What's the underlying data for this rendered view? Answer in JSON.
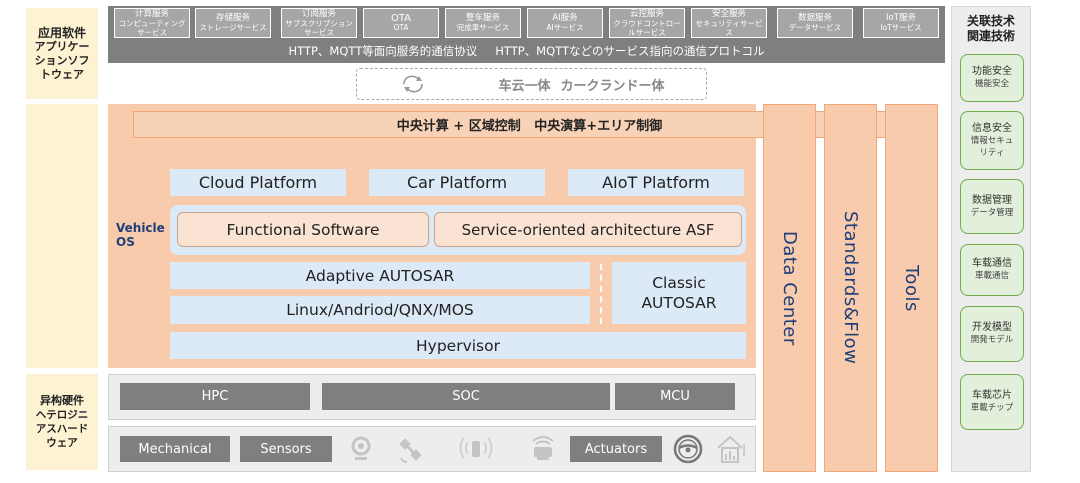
{
  "left_labels": {
    "app_software": {
      "zh": "应用软件",
      "jp": "アプリケーションソフトウェア"
    },
    "hetero_hardware": {
      "zh": "异构硬件",
      "jp": "ヘテロジニアスハードウェア"
    }
  },
  "services": [
    {
      "zh": "计算服务",
      "jp": "コンピューティングサービス"
    },
    {
      "zh": "存储服务",
      "jp": "ストレージサービス"
    },
    {
      "zh": "订阅服务",
      "jp": "サブスクリプションサービス"
    },
    {
      "zh": "OTA",
      "jp": "OTA"
    },
    {
      "zh": "整车服务",
      "jp": "完成車サービス"
    },
    {
      "zh": "AI服务",
      "jp": "AIサービス"
    },
    {
      "zh": "云控服务",
      "jp": "クラウドコントロールサービス"
    },
    {
      "zh": "安全服务",
      "jp": "セキュリティサービス"
    },
    {
      "zh": "数据服务",
      "jp": "データサービス"
    },
    {
      "zh": "IoT服务",
      "jp": "IoTサービス"
    }
  ],
  "protocol": {
    "zh": "HTTP、MQTT等面向服务的通信协议",
    "jp": "HTTP、MQTTなどのサービス指向の通信プロトコル"
  },
  "car_cloud": {
    "zh": "车云一体",
    "jp": "カークランドー体"
  },
  "vehicle_os": {
    "label_line1": "Vehicle",
    "label_line2": "OS",
    "compute_bar": "中央计算 + 区域控制   中央演算+エリア制御",
    "platforms": [
      "Cloud Platform",
      "Car Platform",
      "AIoT Platform"
    ],
    "functional_software": "Functional Software",
    "soa": "Service-oriented architecture ASF",
    "adaptive": "Adaptive AUTOSAR",
    "linux": "Linux/Andriod/QNX/MOS",
    "classic_line1": "Classic",
    "classic_line2": "AUTOSAR",
    "hypervisor": "Hypervisor"
  },
  "vertical_columns": [
    "Data Center",
    "Standards&Flow",
    "Tools"
  ],
  "hardware": {
    "chips": [
      "HPC",
      "SOC",
      "MCU"
    ],
    "mechanical": "Mechanical",
    "sensors": "Sensors",
    "actuators": "Actuators",
    "icons": [
      "camera-icon",
      "satellite-icon",
      "radar-icon",
      "lidar-icon",
      "steering-wheel-icon",
      "house-signal-icon"
    ]
  },
  "right_panel": {
    "title_line1": "关联技术",
    "title_line2": "関連技術",
    "items": [
      {
        "zh": "功能安全",
        "jp": "機能安全"
      },
      {
        "zh": "信息安全",
        "jp": "情報セキュリティ"
      },
      {
        "zh": "数据管理",
        "jp": "データ管理"
      },
      {
        "zh": "车载通信",
        "jp": "車載通信"
      },
      {
        "zh": "开发模型",
        "jp": "開発モデル"
      },
      {
        "zh": "车载芯片",
        "jp": "車載チップ"
      }
    ]
  },
  "colors": {
    "left_label_bg": "#fdf3d3",
    "service_bar": "#7f7f7f",
    "vehicle_os_bg": "#f7cbab",
    "platform_bg": "#dce9f6",
    "right_item_border": "#70ad47",
    "text_blue": "#1f3f7a"
  }
}
